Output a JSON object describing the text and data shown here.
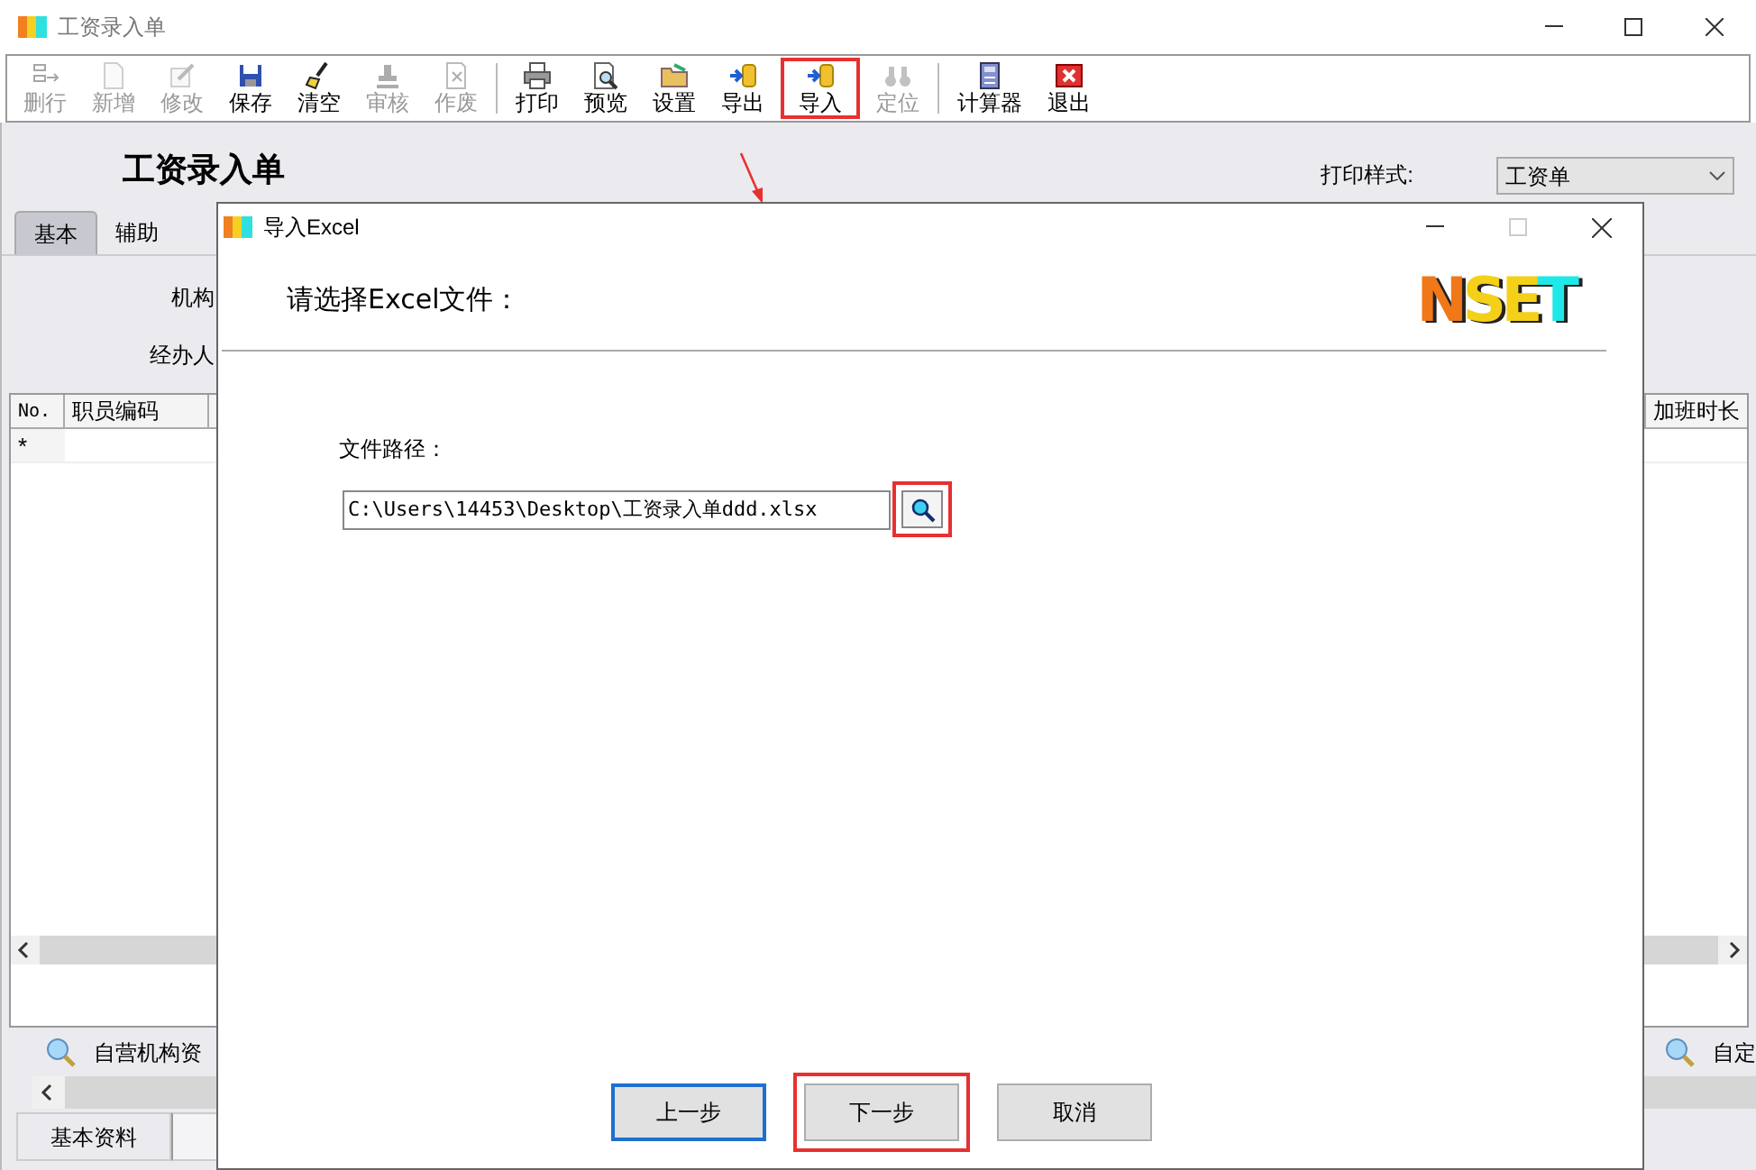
{
  "window": {
    "title": "工资录入单"
  },
  "toolbar": [
    {
      "label": "删行",
      "disabled": true,
      "highlighted": false,
      "separator_after": false
    },
    {
      "label": "新增",
      "disabled": true,
      "highlighted": false,
      "separator_after": false
    },
    {
      "label": "修改",
      "disabled": true,
      "highlighted": false,
      "separator_after": false
    },
    {
      "label": "保存",
      "disabled": false,
      "highlighted": false,
      "separator_after": false
    },
    {
      "label": "清空",
      "disabled": false,
      "highlighted": false,
      "separator_after": false
    },
    {
      "label": "审核",
      "disabled": true,
      "highlighted": false,
      "separator_after": false
    },
    {
      "label": "作废",
      "disabled": true,
      "highlighted": false,
      "separator_after": true
    },
    {
      "label": "打印",
      "disabled": false,
      "highlighted": false,
      "separator_after": false
    },
    {
      "label": "预览",
      "disabled": false,
      "highlighted": false,
      "separator_after": false
    },
    {
      "label": "设置",
      "disabled": false,
      "highlighted": false,
      "separator_after": false
    },
    {
      "label": "导出",
      "disabled": false,
      "highlighted": false,
      "separator_after": false
    },
    {
      "label": "导入",
      "disabled": false,
      "highlighted": true,
      "separator_after": false
    },
    {
      "label": "定位",
      "disabled": true,
      "highlighted": false,
      "separator_after": true
    },
    {
      "label": "计算器",
      "disabled": false,
      "highlighted": false,
      "separator_after": false
    },
    {
      "label": "退出",
      "disabled": false,
      "highlighted": false,
      "separator_after": false
    }
  ],
  "form": {
    "title": "工资录入单",
    "print_style_label": "打印样式:",
    "print_style_value": "工资单",
    "tabs": [
      {
        "label": "基本",
        "selected": true
      },
      {
        "label": "辅助",
        "selected": false
      }
    ],
    "fields": [
      {
        "label": "机构"
      },
      {
        "label": "经办人"
      }
    ]
  },
  "grid": {
    "columns": [
      "No.",
      "职员编码",
      "加班时长"
    ],
    "new_row_marker": "*"
  },
  "lower_panel": {
    "search_items": [
      "自营机构资",
      "自定"
    ],
    "tabs": [
      {
        "label": "基本资料",
        "selected": true
      },
      {
        "selected": false
      }
    ]
  },
  "annotation": {
    "arrow": true
  },
  "dialog": {
    "title": "导入Excel",
    "heading": "请选择Excel文件：",
    "logo": "NSET",
    "path_label": "文件路径：",
    "path_value": "C:\\Users\\14453\\Desktop\\工资录入单ddd.xlsx",
    "browse_highlighted": true,
    "buttons": [
      {
        "label": "上一步",
        "focused": true,
        "highlighted": false
      },
      {
        "label": "下一步",
        "focused": false,
        "highlighted": true
      },
      {
        "label": "取消",
        "focused": false,
        "highlighted": false
      }
    ]
  }
}
